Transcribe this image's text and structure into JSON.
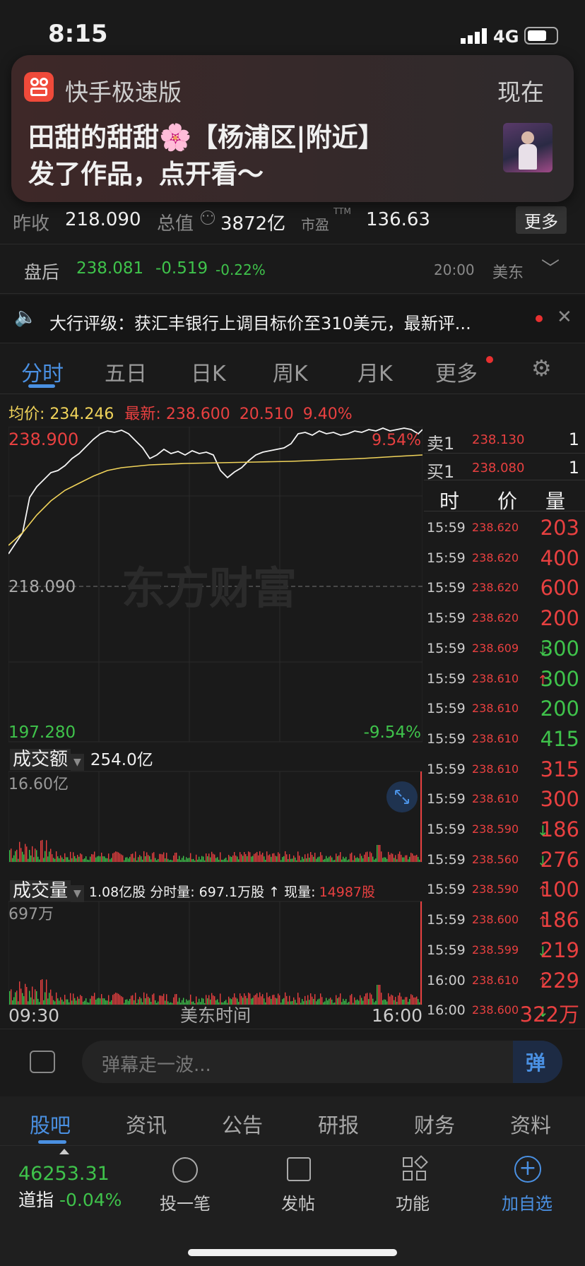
{
  "status": {
    "time": "8:15",
    "network": "4G"
  },
  "notification": {
    "app": "快手极速版",
    "time": "现在",
    "title": "田甜的甜甜🌸【杨浦区|附近】",
    "body": "发了作品，点开看～"
  },
  "quote": {
    "prev_close_label": "昨收",
    "prev_close": "218.090",
    "mcap_label": "总值",
    "mcap": "3872亿",
    "pe_label": "市盈",
    "pe_sup": "TTM",
    "pe": "136.63",
    "more": "更多"
  },
  "after_hours": {
    "label": "盘后",
    "price": "238.081",
    "change": "-0.519",
    "pct": "-0.22%",
    "time": "20:00",
    "zone": "美东"
  },
  "news": {
    "text": "大行评级：获汇丰银行上调目标价至310美元，最新评..."
  },
  "tabs": [
    "分时",
    "五日",
    "日K",
    "周K",
    "月K",
    "更多"
  ],
  "summary": {
    "avg_label": "均价:",
    "avg": "234.246",
    "last_label": "最新:",
    "last": "238.600",
    "chg": "20.510",
    "pct": "9.40%"
  },
  "chart": {
    "top_price": "238.900",
    "top_pct": "9.54%",
    "mid_price": "218.090",
    "bottom_price": "197.280",
    "bottom_pct": "-9.54%",
    "watermark": "东方财富",
    "turnover_label": "成交额",
    "turnover": "254.0亿",
    "turnover_max": "16.60亿",
    "volume_label": "成交量",
    "volume_info": "1.08亿股 分时量: 697.1万股 ↑ 现量:",
    "volume_now": "14987股",
    "volume_max": "697万",
    "x_start": "09:30",
    "x_mid": "美东时间",
    "x_end": "16:00"
  },
  "orderbook": {
    "sell_label": "卖1",
    "sell_price": "238.130",
    "sell_qty": "1",
    "buy_label": "买1",
    "buy_price": "238.080",
    "buy_qty": "1",
    "head_time": "时",
    "head_price": "价",
    "head_qty": "量"
  },
  "trades": [
    {
      "t": "15:59",
      "p": "238.620",
      "a": "",
      "q": "203",
      "c": "red"
    },
    {
      "t": "15:59",
      "p": "238.620",
      "a": "",
      "q": "400",
      "c": "red"
    },
    {
      "t": "15:59",
      "p": "238.620",
      "a": "",
      "q": "600",
      "c": "red"
    },
    {
      "t": "15:59",
      "p": "238.620",
      "a": "",
      "q": "200",
      "c": "red"
    },
    {
      "t": "15:59",
      "p": "238.609",
      "a": "↓",
      "q": "300",
      "c": "green"
    },
    {
      "t": "15:59",
      "p": "238.610",
      "a": "↑",
      "q": "300",
      "c": "green"
    },
    {
      "t": "15:59",
      "p": "238.610",
      "a": "",
      "q": "200",
      "c": "green"
    },
    {
      "t": "15:59",
      "p": "238.610",
      "a": "",
      "q": "415",
      "c": "green"
    },
    {
      "t": "15:59",
      "p": "238.610",
      "a": "",
      "q": "315",
      "c": "red"
    },
    {
      "t": "15:59",
      "p": "238.610",
      "a": "",
      "q": "300",
      "c": "red"
    },
    {
      "t": "15:59",
      "p": "238.590",
      "a": "↓",
      "q": "186",
      "c": "red"
    },
    {
      "t": "15:59",
      "p": "238.560",
      "a": "↓",
      "q": "276",
      "c": "red"
    },
    {
      "t": "15:59",
      "p": "238.590",
      "a": "↑",
      "q": "100",
      "c": "red"
    },
    {
      "t": "15:59",
      "p": "238.600",
      "a": "↑",
      "q": "186",
      "c": "red"
    },
    {
      "t": "15:59",
      "p": "238.599",
      "a": "↓",
      "q": "219",
      "c": "red"
    },
    {
      "t": "16:00",
      "p": "238.610",
      "a": "↑",
      "q": "229",
      "c": "red"
    },
    {
      "t": "16:00",
      "p": "238.600",
      "a": "↓",
      "q": "322万",
      "c": "red"
    }
  ],
  "comment": {
    "placeholder": "弹幕走一波...",
    "send": "弹"
  },
  "bottom_tabs": [
    "股吧",
    "资讯",
    "公告",
    "研报",
    "财务",
    "资料"
  ],
  "footer": {
    "index_value": "46253.31",
    "index_name": "道指",
    "index_pct": "-0.04%",
    "nav": [
      "投一笔",
      "发帖",
      "功能",
      "加自选"
    ]
  },
  "colors": {
    "up": "#e84040",
    "down": "#3fc34b",
    "accent": "#4a90e2",
    "avg": "#f0d35a"
  }
}
